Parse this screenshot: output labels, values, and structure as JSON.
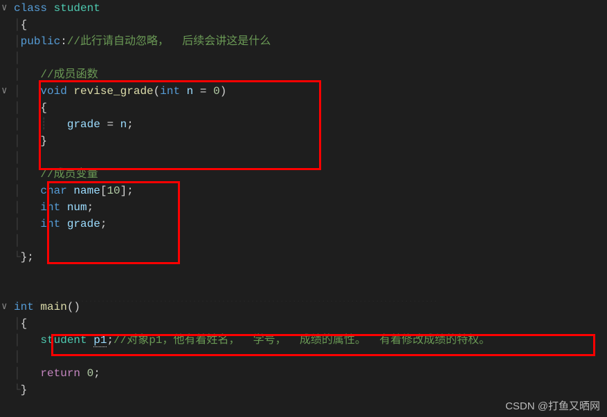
{
  "code": {
    "class_kw": "class",
    "class_name": "student",
    "obrace": "{",
    "public_kw": "public",
    "public_comment": "//此行请自动忽略，  后续会讲这是什么",
    "member_fn_comment": "//成员函数",
    "void_kw": "void",
    "fn_name": "revise_grade",
    "int_kw": "int",
    "param_n": "n",
    "eq": " = ",
    "zero": "0",
    "fn_obrace": "{",
    "assign_left": "grade",
    "assign_eq": " = ",
    "assign_right": "n",
    "semi": ";",
    "fn_cbrace": "}",
    "member_var_comment": "//成员变量",
    "char_kw": "char",
    "name_var": "name",
    "arr_size": "10",
    "num_var": "num",
    "grade_var": "grade",
    "class_cbrace": "};",
    "main_int": "int",
    "main_name": "main",
    "main_obrace": "{",
    "student_type": "student",
    "p1_var": "p1",
    "p1_comment": "//对象p1，他有着姓名，  学号，  成绩的属性。  有着修改成绩的特权。",
    "return_kw": "return",
    "return_val": "0",
    "main_cbrace": "}"
  },
  "watermark": "CSDN @打鱼又晒网"
}
